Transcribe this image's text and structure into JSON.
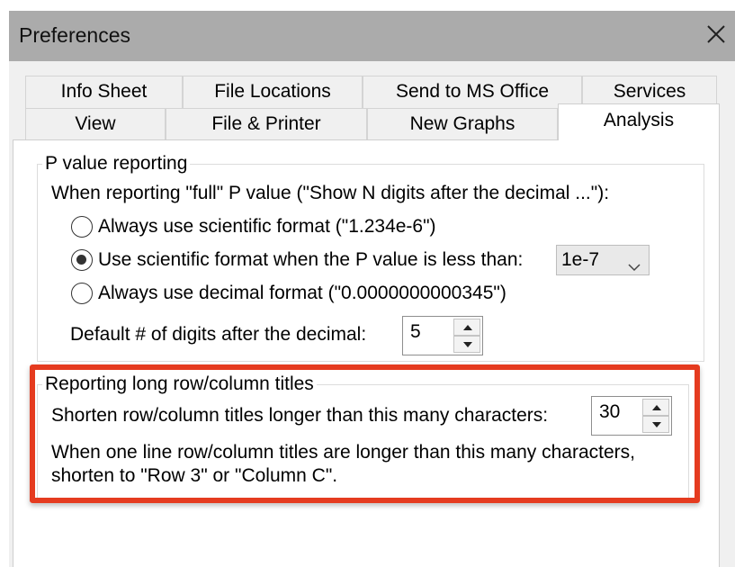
{
  "window": {
    "title": "Preferences",
    "close_icon": "close-icon"
  },
  "tabs": {
    "row_back": [
      "Info Sheet",
      "File Locations",
      "Send to MS Office",
      "Services"
    ],
    "row_front": [
      "View",
      "File & Printer",
      "New Graphs",
      "Analysis"
    ],
    "active": "Analysis"
  },
  "p_value": {
    "legend": "P value reporting",
    "intro": "When reporting \"full\" P value (\"Show N digits after the decimal ...\"):",
    "options": [
      {
        "label": "Always use scientific format (\"1.234e-6\")",
        "checked": false
      },
      {
        "label": "Use scientific format when the P value is less than:",
        "checked": true
      },
      {
        "label": "Always use decimal format (\"0.0000000000345\")",
        "checked": false
      }
    ],
    "threshold_value": "1e-7",
    "digits_label": "Default # of digits after the decimal:",
    "digits_value": "5"
  },
  "titles": {
    "legend": "Reporting long row/column titles",
    "shorten_label": "Shorten row/column titles longer than this many characters:",
    "shorten_value": "30",
    "note_line1": "When one line row/column titles are longer than this many characters,",
    "note_line2": "shorten to \"Row 3\" or \"Column C\"."
  },
  "colors": {
    "highlight": "#e53b1f",
    "titlebar": "#ababab"
  }
}
